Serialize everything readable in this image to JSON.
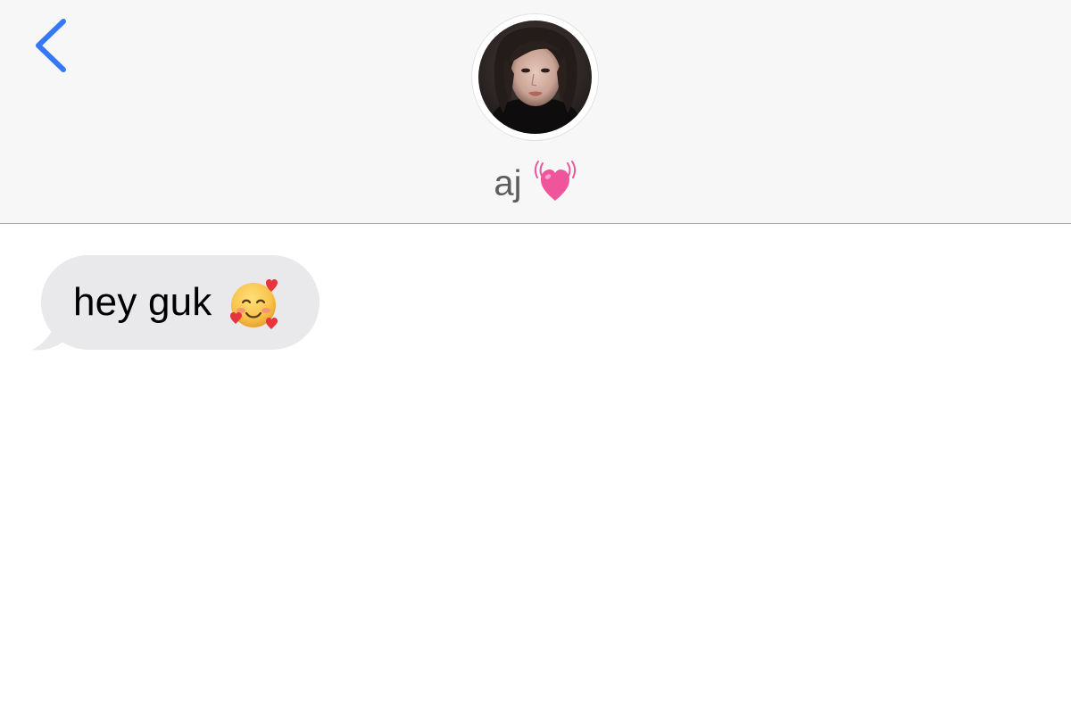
{
  "header": {
    "back_icon": "chevron-left-icon",
    "contact_name": "aj",
    "name_emoji": "beating-heart-emoji",
    "avatar": "contact-avatar-photo"
  },
  "messages": [
    {
      "direction": "received",
      "text": "hey guk",
      "emoji": "smiling-face-with-hearts-emoji"
    }
  ],
  "colors": {
    "header_bg": "#f7f7f7",
    "accent_blue": "#3478f6",
    "received_bubble": "#e9e9eb",
    "name_text": "#5d5d5d",
    "heart_pink": "#f0559c"
  }
}
